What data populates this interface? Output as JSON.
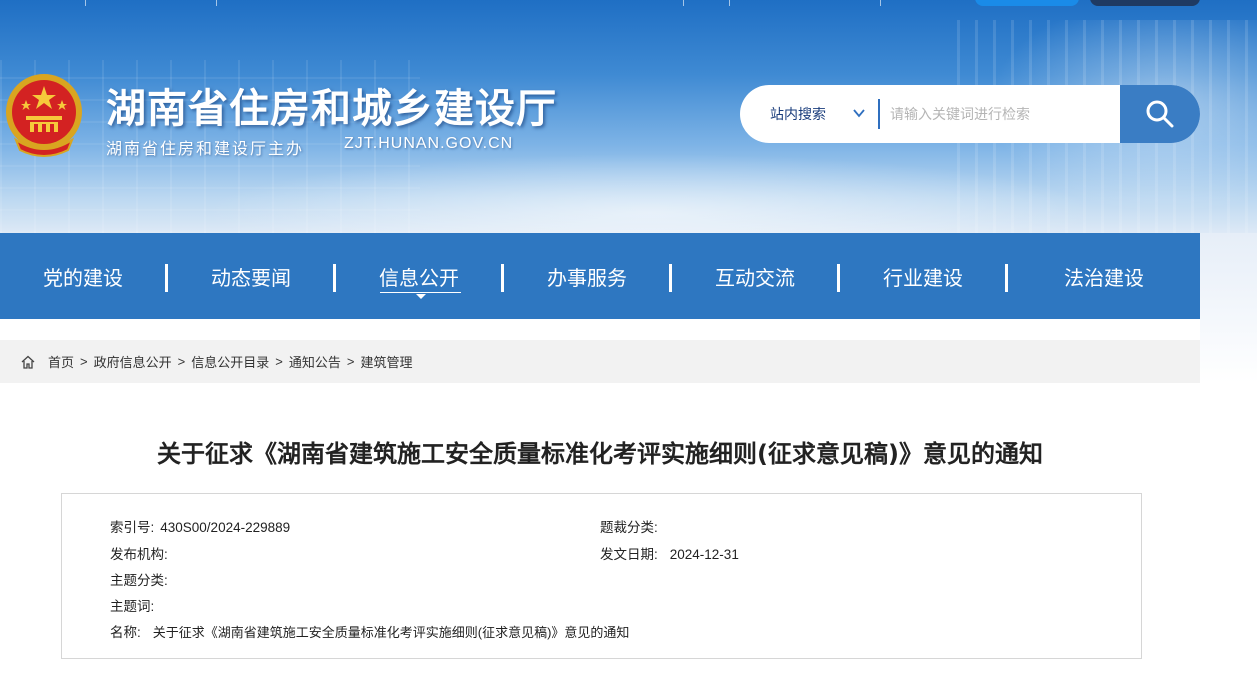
{
  "header": {
    "site_title": "湖南省住房和城乡建设厅",
    "site_subtitle": "湖南省住房和建设厅主办",
    "site_domain": "ZJT.HUNAN.GOV.CN",
    "emblem_icon": "national-emblem-icon"
  },
  "search": {
    "scope_label": "站内搜索",
    "placeholder": "请输入关键词进行检索",
    "value": ""
  },
  "nav": {
    "items": [
      {
        "label": "党的建设"
      },
      {
        "label": "动态要闻"
      },
      {
        "label": "信息公开",
        "active": true
      },
      {
        "label": "办事服务"
      },
      {
        "label": "互动交流"
      },
      {
        "label": "行业建设"
      },
      {
        "label": "法治建设"
      }
    ]
  },
  "breadcrumb": {
    "items": [
      "首页",
      "政府信息公开",
      "信息公开目录",
      "通知公告",
      "建筑管理"
    ],
    "separator": ">"
  },
  "article": {
    "title": "关于征求《湖南省建筑施工安全质量标准化考评实施细则(征求意见稿)》意见的通知",
    "meta": {
      "index_label": "索引号:",
      "index_value": "430S00/2024-229889",
      "topic_class_label": "题裁分类:",
      "topic_class_value": "",
      "publisher_label": "发布机构:",
      "publisher_value": "",
      "date_label": "发文日期:",
      "date_value": "2024-12-31",
      "subject_class_label": "主题分类:",
      "subject_class_value": "",
      "subject_words_label": "主题词:",
      "subject_words_value": "",
      "name_label": "名称:",
      "name_value": "关于征求《湖南省建筑施工安全质量标准化考评实施细则(征求意见稿)》意见的通知"
    }
  },
  "colors": {
    "nav_bg": "#2e77c1",
    "search_button": "#3a7dc4",
    "breadcrumb_bg": "#f2f2f2"
  }
}
